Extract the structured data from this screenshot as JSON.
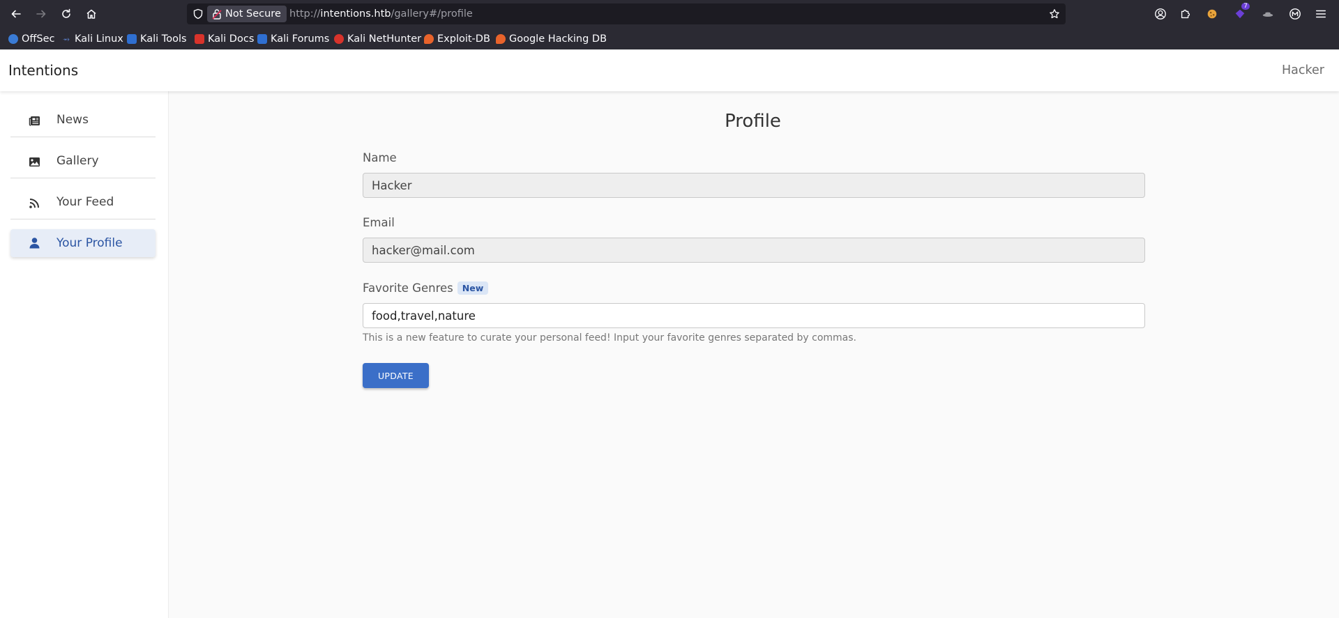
{
  "browser": {
    "security_label": "Not Secure",
    "url_prefix": "http://",
    "url_host": "intentions.htb",
    "url_path": "/gallery#/profile",
    "bookmarks": [
      {
        "label": "OffSec",
        "color": "#3a7bd5"
      },
      {
        "label": "Kali Linux",
        "color": "#5b7fc9"
      },
      {
        "label": "Kali Tools",
        "color": "#2f6fd1"
      },
      {
        "label": "Kali Docs",
        "color": "#d8332b"
      },
      {
        "label": "Kali Forums",
        "color": "#2f6fd1"
      },
      {
        "label": "Kali NetHunter",
        "color": "#d8332b"
      },
      {
        "label": "Exploit-DB",
        "color": "#e8632b"
      },
      {
        "label": "Google Hacking DB",
        "color": "#e8632b"
      }
    ],
    "extension_badge": "7"
  },
  "app": {
    "brand": "Intentions",
    "user": "Hacker"
  },
  "sidebar": {
    "items": [
      {
        "label": "News",
        "icon": "newspaper-icon",
        "active": false
      },
      {
        "label": "Gallery",
        "icon": "image-icon",
        "active": false
      },
      {
        "label": "Your Feed",
        "icon": "rss-icon",
        "active": false
      },
      {
        "label": "Your Profile",
        "icon": "user-icon",
        "active": true
      }
    ]
  },
  "profile": {
    "title": "Profile",
    "name_label": "Name",
    "name_value": "Hacker",
    "email_label": "Email",
    "email_value": "hacker@mail.com",
    "genres_label": "Favorite Genres",
    "genres_badge": "New",
    "genres_value": "food,travel,nature",
    "help_text": "This is a new feature to curate your personal feed! Input your favorite genres separated by commas.",
    "update_label": "UPDATE"
  },
  "colors": {
    "accent": "#3b6fc8",
    "active_bg": "#e7edf7",
    "chrome_bg": "#2b2a33"
  }
}
